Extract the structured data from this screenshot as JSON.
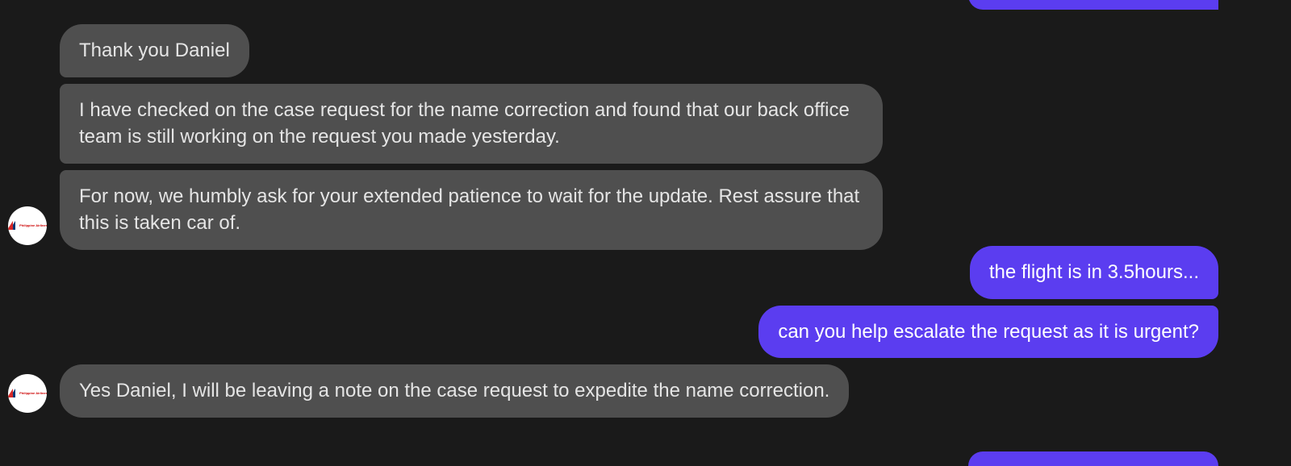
{
  "conversation": {
    "agent_name": "Philippine Airlines",
    "group1": {
      "msg1": "Thank you  Daniel",
      "msg2": "I have checked on the case request for the name correction and found that our back office team is still working on the request you made yesterday.",
      "msg3": "For now, we humbly ask for your extended patience to wait for the update. Rest assure that this is taken car of."
    },
    "group2": {
      "msg1": "the flight is in 3.5hours...",
      "msg2": "can you help escalate the request as it is urgent?"
    },
    "group3": {
      "msg1": "Yes Daniel, I will be leaving a note on the case request to expedite the name correction."
    }
  }
}
